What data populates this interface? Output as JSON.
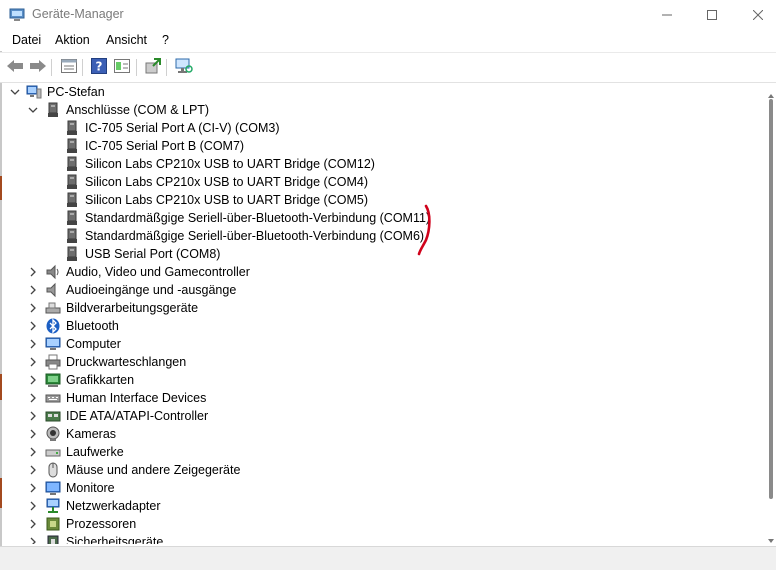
{
  "window": {
    "title": "Geräte-Manager",
    "controls": {
      "minimize": "minimize-icon",
      "maximize": "maximize-icon",
      "close": "close-icon"
    }
  },
  "menu": [
    "Datei",
    "Aktion",
    "Ansicht",
    "?"
  ],
  "toolbar": {
    "buttons": [
      "back-arrow-icon",
      "forward-arrow-icon",
      "properties-icon",
      "help-icon",
      "view-icon",
      "update-driver-icon",
      "scan-hardware-icon"
    ]
  },
  "tree": {
    "root": "PC-Stefan",
    "expanded_category": "Anschlüsse (COM & LPT)",
    "ports": [
      "IC-705 Serial Port A (CI-V) (COM3)",
      "IC-705 Serial Port B (COM7)",
      "Silicon Labs CP210x USB to UART Bridge (COM12)",
      "Silicon Labs CP210x USB to UART Bridge (COM4)",
      "Silicon Labs CP210x USB to UART Bridge (COM5)",
      "Standardmäßgige Seriell-über-Bluetooth-Verbindung (COM11)",
      "Standardmäßgige Seriell-über-Bluetooth-Verbindung (COM6)",
      "USB Serial Port (COM8)"
    ],
    "categories": [
      "Audio, Video und Gamecontroller",
      "Audioeingänge und -ausgänge",
      "Bildverarbeitungsgeräte",
      "Bluetooth",
      "Computer",
      "Druckwarteschlangen",
      "Grafikkarten",
      "Human Interface Devices",
      "IDE ATA/ATAPI-Controller",
      "Kameras",
      "Laufwerke",
      "Mäuse und andere Zeigegeräte",
      "Monitore",
      "Netzwerkadapter",
      "Prozessoren",
      "Sicherheitsgeräte"
    ]
  },
  "colors": {
    "annotation": "#d0021b",
    "accent": "#0067c0"
  }
}
